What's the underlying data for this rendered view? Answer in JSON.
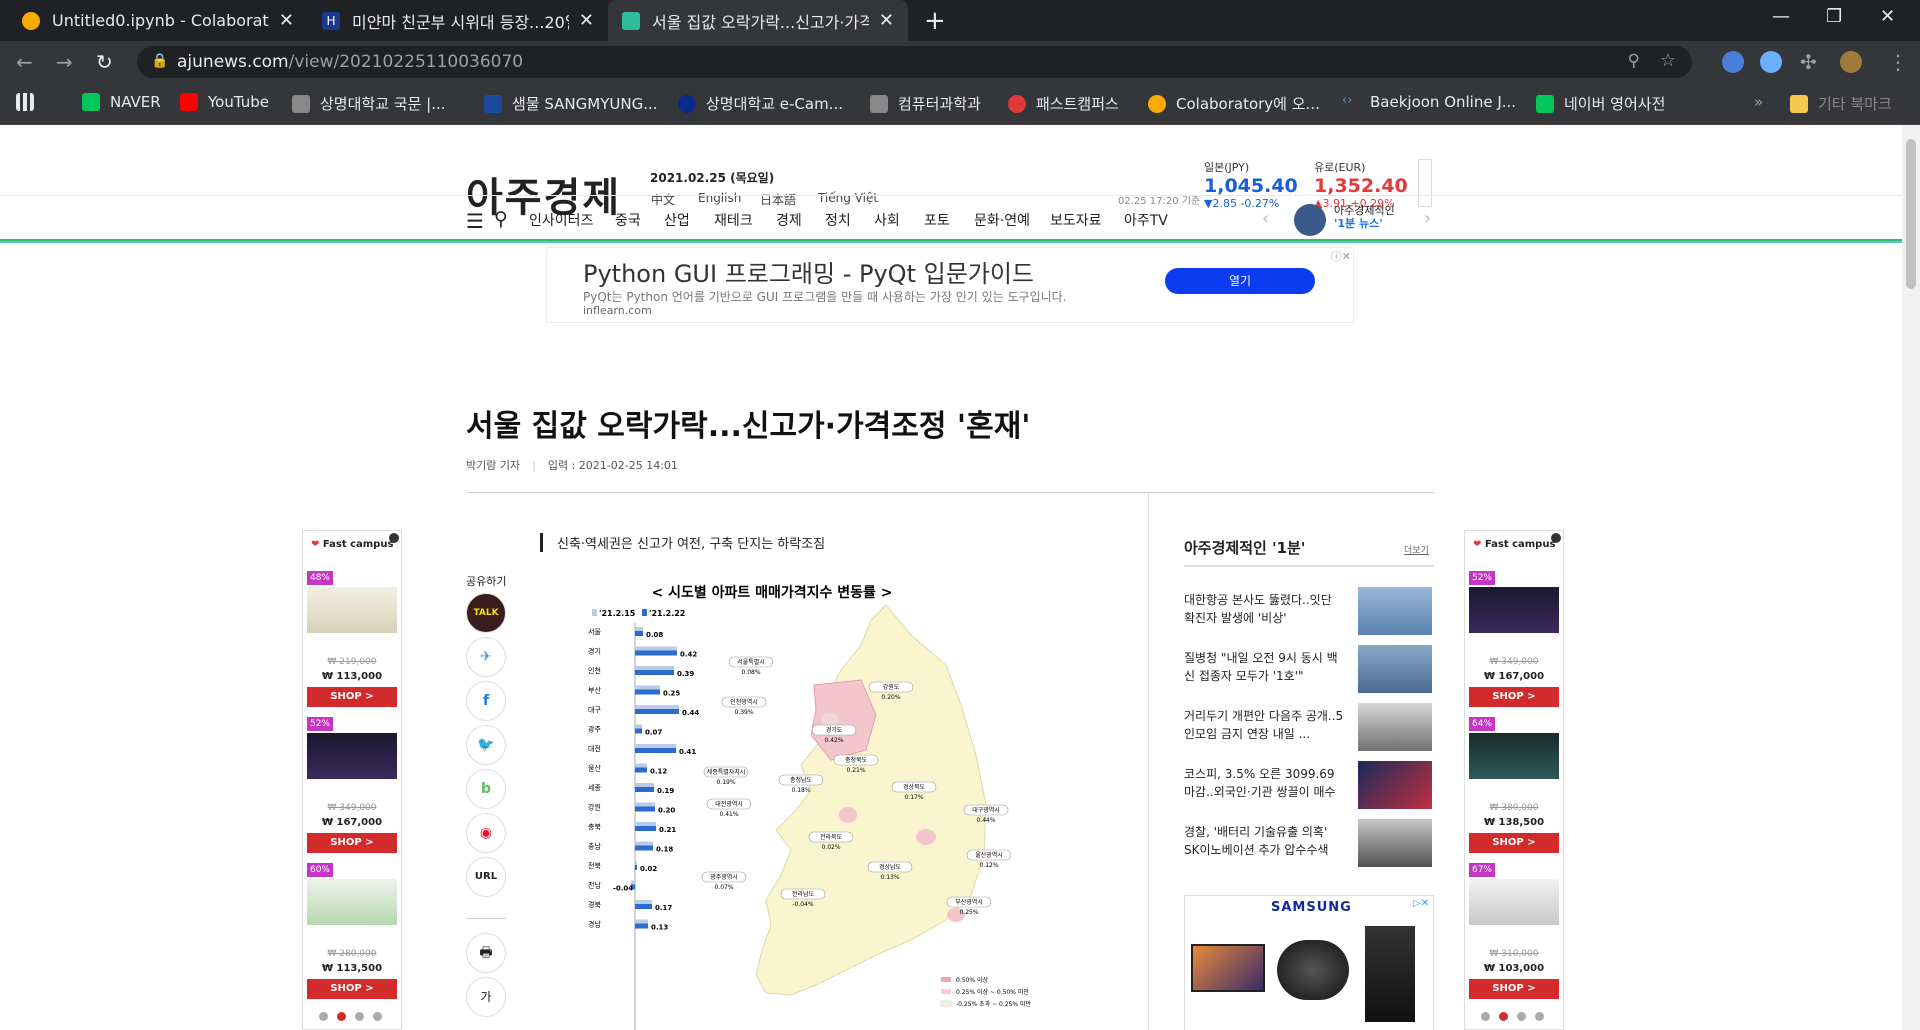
{
  "browser": {
    "tabs": [
      {
        "title": "Untitled0.ipynb - Colaboratory",
        "icon": "colab-icon",
        "active": false
      },
      {
        "title": "미얀마 친군부 시위대 등장...20일",
        "icon": "hankook-icon",
        "active": false
      },
      {
        "title": "서울 집값 오락가락...신고가·가격조",
        "icon": "ajunews-icon",
        "active": true
      }
    ],
    "url_host": "ajunews.com",
    "url_path": "/view/20210225110036070",
    "bookmarks": [
      {
        "label": "",
        "icon": "apps-icon"
      },
      {
        "label": "NAVER",
        "icon": "naver-icon"
      },
      {
        "label": "YouTube",
        "icon": "youtube-icon"
      },
      {
        "label": "상명대학교 국문 |...",
        "icon": "smu-icon"
      },
      {
        "label": "샘물 SANGMYUNG...",
        "icon": "smu-icon"
      },
      {
        "label": "상명대학교 e-Cam...",
        "icon": "ecampus-icon"
      },
      {
        "label": "컴퓨터과학과",
        "icon": "smu-icon"
      },
      {
        "label": "패스트캠퍼스",
        "icon": "fastcampus-icon"
      },
      {
        "label": "Colaboratory에 오...",
        "icon": "colab-icon"
      },
      {
        "label": "Baekjoon Online J...",
        "icon": "code-icon"
      },
      {
        "label": "네이버 영어사전",
        "icon": "naver-dict-icon"
      },
      {
        "label": "기타 북마크",
        "icon": "folder-icon"
      }
    ]
  },
  "site": {
    "logo": "아주경제",
    "date": "2021.02.25 (목요일)",
    "languages": [
      "中文",
      "English",
      "日本語",
      "Tiếng Việt"
    ],
    "fx_time": "02.25 17:20 기준",
    "fx": [
      {
        "name": "일본(JPY)",
        "value": "1,045.40",
        "change": "▼2.85  -0.27%",
        "color": "#1a5fd8"
      },
      {
        "name": "유로(EUR)",
        "value": "1,352.40",
        "change": "▲3.91  +0.29%",
        "color": "#e23a3a"
      }
    ],
    "nav": [
      "인사이터즈",
      "중국",
      "산업",
      "재테크",
      "경제",
      "정치",
      "사회",
      "포토",
      "문화·연예",
      "보도자료",
      "아주TV"
    ],
    "news1_line1": "아주경제적인",
    "news1_line2": "'1분 뉴스'"
  },
  "ad": {
    "title": "Python GUI 프로그래밍 - PyQt 입문가이드",
    "desc": "PyQt는 Python 언어를 기반으로 GUI 프로그램을 만들 때 사용하는 가장 인기 있는 도구입니다.",
    "url": "inflearn.com",
    "button": "열기"
  },
  "article": {
    "title": "서울 집값 오락가락...신고가·가격조정 '혼재'",
    "author": "박기람 기자",
    "input_date": "입력 : 2021-02-25 14:01",
    "subheading": "신축·역세권은 신고가 여전, 구축 단지는 하락조짐",
    "share_label": "공유하기",
    "share_buttons": [
      "TALK",
      "✈",
      "f",
      "🐦",
      "b",
      "◉",
      "URL"
    ],
    "tools": [
      "🖶",
      "가"
    ]
  },
  "side_ads": {
    "brand": "Fast campus",
    "left": [
      {
        "pct": "48%",
        "old": "₩ 219,000",
        "new": "₩ 113,000"
      },
      {
        "pct": "52%",
        "old": "₩ 349,000",
        "new": "₩ 167,000"
      },
      {
        "pct": "60%",
        "old": "₩ 280,000",
        "new": "₩ 113,500"
      }
    ],
    "right": [
      {
        "pct": "52%",
        "old": "₩ 349,000",
        "new": "₩ 167,000"
      },
      {
        "pct": "64%",
        "old": "₩ 380,000",
        "new": "₩ 138,500"
      },
      {
        "pct": "67%",
        "old": "₩ 310,000",
        "new": "₩ 103,000"
      }
    ],
    "shop": "SHOP >"
  },
  "sidebar": {
    "title": "아주경제적인 '1분'",
    "more": "더보기",
    "news": [
      "대한항공 본사도 뚫렸다..잇단 확진자 발생에 '비상'",
      "질병청 \"내일 오전 9시 동시 백신 접종자 모두가 '1호'\"",
      "거리두기 개편안 다음주 공개..5인모임 금지 연장 내일 ...",
      "코스피, 3.5% 오른 3099.69 마감..외국인·기관 쌍끌이 매수",
      "경찰, '배터리 기술유출 의혹' SK이노베이션 추가 압수수색"
    ],
    "samsung": "SAMSUNG"
  },
  "chart_data": {
    "type": "bar",
    "title": "< 시도별 아파트 매매가격지수 변동률 >",
    "legend": [
      "'21.2.15",
      "'21.2.22"
    ],
    "categories": [
      "서울",
      "경기",
      "인천",
      "부산",
      "대구",
      "광주",
      "대전",
      "울산",
      "세종",
      "강원",
      "충북",
      "충남",
      "전북",
      "전남",
      "경북",
      "경남"
    ],
    "values": [
      0.08,
      0.42,
      0.39,
      0.25,
      0.44,
      0.07,
      0.41,
      0.12,
      0.19,
      0.2,
      0.21,
      0.18,
      0.02,
      -0.04,
      0.17,
      0.13
    ],
    "map_labels": [
      {
        "name": "서울특별시",
        "value": "0.08%"
      },
      {
        "name": "인천광역시",
        "value": "0.39%"
      },
      {
        "name": "강원도",
        "value": "0.20%"
      },
      {
        "name": "경기도",
        "value": "0.42%"
      },
      {
        "name": "충청북도",
        "value": "0.21%"
      },
      {
        "name": "세종특별자치시",
        "value": "0.19%"
      },
      {
        "name": "충청남도",
        "value": "0.18%"
      },
      {
        "name": "경상북도",
        "value": "0.17%"
      },
      {
        "name": "대전광역시",
        "value": "0.41%"
      },
      {
        "name": "대구광역시",
        "value": "0.44%"
      },
      {
        "name": "전라북도",
        "value": "0.02%"
      },
      {
        "name": "울산광역시",
        "value": "0.12%"
      },
      {
        "name": "경상남도",
        "value": "0.13%"
      },
      {
        "name": "광주광역시",
        "value": "0.07%"
      },
      {
        "name": "전라남도",
        "value": "-0.04%"
      },
      {
        "name": "부산광역시",
        "value": "0.25%"
      }
    ],
    "map_legend": [
      "0.50% 이상",
      "0.25% 이상 ~ 0.50% 미만",
      "-0.25% 초과 ~ 0.25% 미만"
    ]
  }
}
